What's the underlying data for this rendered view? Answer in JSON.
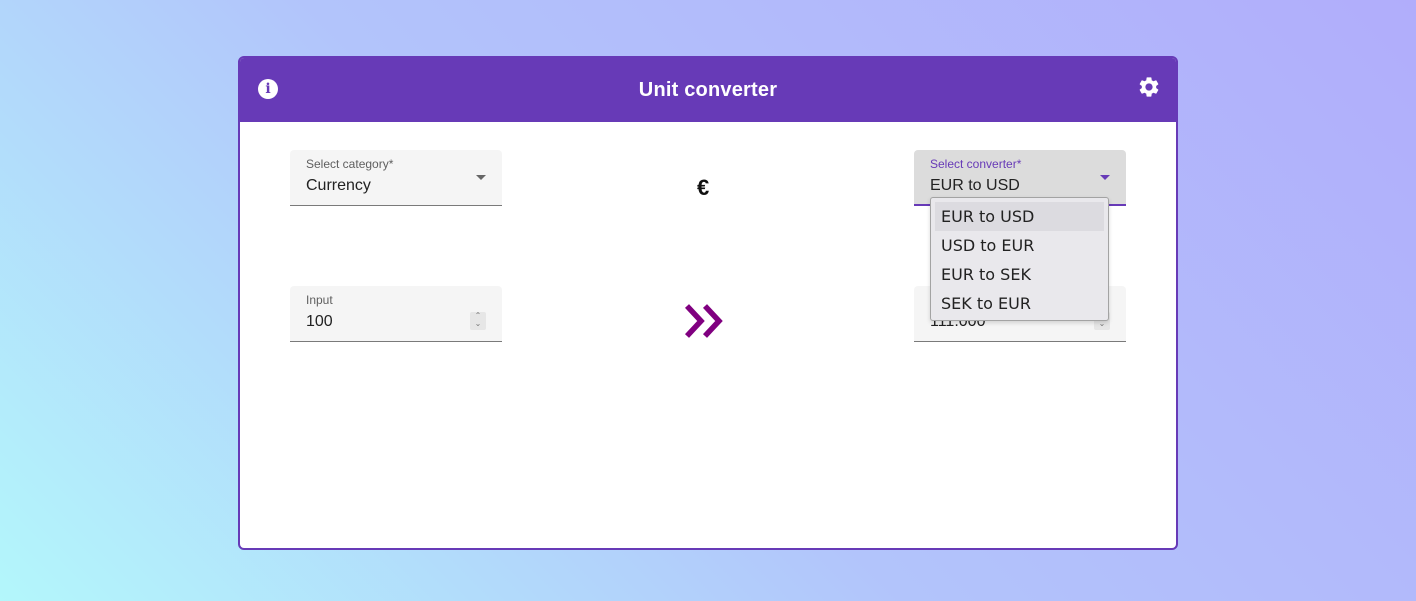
{
  "app": {
    "title": "Unit converter"
  },
  "icons": {
    "info": "info-icon",
    "settings": "gear-icon",
    "symbol": "euro-icon",
    "convert": "double-chevron-right-icon"
  },
  "colors": {
    "primary": "#673ab7",
    "arrow": "#800080"
  },
  "category": {
    "label": "Select category*",
    "value": "Currency"
  },
  "unit_symbol": "€",
  "converter": {
    "label": "Select converter*",
    "value": "EUR to USD",
    "options": [
      "EUR to USD",
      "USD to EUR",
      "EUR to SEK",
      "SEK to EUR"
    ],
    "selected_index": 0
  },
  "input": {
    "label": "Input",
    "value": "100"
  },
  "output": {
    "value": "111.000"
  }
}
